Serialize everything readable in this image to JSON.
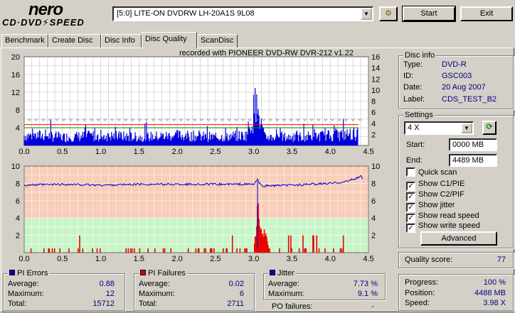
{
  "app": {
    "logo_top": "nero",
    "logo_bottom": "CD·DVD⚡SPEED"
  },
  "toolbar": {
    "drive": "[5:0]   LITE-ON DVDRW LH-20A1S 9L08",
    "start_label": "Start",
    "exit_label": "Exit"
  },
  "tabs": [
    {
      "label": "Benchmark"
    },
    {
      "label": "Create Disc"
    },
    {
      "label": "Disc Info"
    },
    {
      "label": "Disc Quality",
      "active": true
    },
    {
      "label": "ScanDisc"
    }
  ],
  "recorded_with": "recorded with PIONEER DVD-RW  DVR-212  v1.22",
  "disc_info": {
    "title": "Disc info",
    "type_label": "Type:",
    "type_value": "DVD-R",
    "id_label": "ID:",
    "id_value": "GSC003",
    "date_label": "Date:",
    "date_value": "20 Aug 2007",
    "label_label": "Label:",
    "label_value": "CDS_TEST_B2"
  },
  "settings": {
    "title": "Settings",
    "speed": "4 X",
    "start_label": "Start:",
    "start_value": "0000 MB",
    "end_label": "End:",
    "end_value": "4489 MB",
    "quick_scan": {
      "label": "Quick scan",
      "checked": false
    },
    "show_c1": {
      "label": "Show C1/PIE",
      "checked": true
    },
    "show_c2": {
      "label": "Show C2/PIF",
      "checked": true
    },
    "show_jitter": {
      "label": "Show jitter",
      "checked": true
    },
    "show_read": {
      "label": "Show read speed",
      "checked": true
    },
    "show_write": {
      "label": "Show write speed",
      "checked": true
    },
    "advanced_label": "Advanced"
  },
  "quality": {
    "label": "Quality score:",
    "value": "77"
  },
  "progress": {
    "progress_label": "Progress:",
    "progress_value": "100 %",
    "position_label": "Position:",
    "position_value": "4488 MB",
    "speed_label": "Speed:",
    "speed_value": "3.98 X"
  },
  "pi_errors": {
    "title": "PI Errors",
    "color": "#0000cc",
    "average_label": "Average:",
    "average": "0.88",
    "maximum_label": "Maximum:",
    "maximum": "12",
    "total_label": "Total:",
    "total": "15712"
  },
  "pi_failures": {
    "title": "PI Failures",
    "color": "#dd0000",
    "average_label": "Average:",
    "average": "0.02",
    "maximum_label": "Maximum:",
    "maximum": "6",
    "total_label": "Total:",
    "total": "2711"
  },
  "jitter": {
    "title": "Jitter",
    "color": "#0000cc",
    "average_label": "Average:",
    "average": "7.73 %",
    "maximum_label": "Maximum:",
    "maximum": "9.1 %"
  },
  "po_failures": {
    "label": "PO failures:",
    "value": "-"
  },
  "chart_data": [
    {
      "type": "bar",
      "name": "pi-errors-chart",
      "x_ticks": [
        "0.0",
        "0.5",
        "1.0",
        "1.5",
        "2.0",
        "2.5",
        "3.0",
        "3.5",
        "4.0",
        "4.5"
      ],
      "y_left_ticks": [
        "20",
        "16",
        "12",
        "8",
        "4"
      ],
      "y_right_ticks": [
        "16",
        "14",
        "12",
        "10",
        "8",
        "6",
        "4",
        "2"
      ],
      "xlim": [
        0,
        4.5
      ],
      "ylim": [
        0,
        20
      ],
      "pie_profile": [
        [
          0,
          3
        ],
        [
          0.3,
          3
        ],
        [
          0.5,
          2.5
        ],
        [
          1.0,
          3
        ],
        [
          1.5,
          2.5
        ],
        [
          2.0,
          3
        ],
        [
          2.5,
          2.5
        ],
        [
          2.9,
          3
        ],
        [
          2.98,
          8
        ],
        [
          3.02,
          12
        ],
        [
          3.06,
          10
        ],
        [
          3.1,
          6
        ],
        [
          3.14,
          2.5
        ],
        [
          3.5,
          2.5
        ],
        [
          4.0,
          3
        ],
        [
          4.37,
          3.5
        ]
      ],
      "red_line_y": 4.7,
      "read_speed_level": 4,
      "grid": true,
      "background": "#ffffff"
    },
    {
      "type": "bar",
      "name": "pi-failures-chart",
      "x_ticks": [
        "0.0",
        "0.5",
        "1.0",
        "1.5",
        "2.0",
        "2.5",
        "3.0",
        "3.5",
        "4.0",
        "4.5"
      ],
      "y_left_ticks": [
        "10",
        "8",
        "6",
        "4",
        "2"
      ],
      "y_right_ticks": [
        "10",
        "8",
        "6",
        "4",
        "2"
      ],
      "xlim": [
        0,
        4.5
      ],
      "ylim": [
        0,
        10
      ],
      "jitter": [
        [
          0,
          7.8
        ],
        [
          0.5,
          7.9
        ],
        [
          1.0,
          7.8
        ],
        [
          1.5,
          7.9
        ],
        [
          2.0,
          7.9
        ],
        [
          2.5,
          7.9
        ],
        [
          3.0,
          7.9
        ],
        [
          3.05,
          8.4
        ],
        [
          3.1,
          7.7
        ],
        [
          3.5,
          7.8
        ],
        [
          4.0,
          8.0
        ],
        [
          4.2,
          8.2
        ],
        [
          4.35,
          8.6
        ],
        [
          4.4,
          8.9
        ],
        [
          4.42,
          8.5
        ]
      ],
      "pif_spike": [
        [
          3.0,
          0.5
        ],
        [
          3.03,
          3
        ],
        [
          3.06,
          7.5
        ],
        [
          3.09,
          3
        ],
        [
          3.15,
          3
        ],
        [
          3.2,
          0.5
        ]
      ],
      "background_high": "#f8cdb9",
      "background_low": "#c8f5c8",
      "threshold": 4
    }
  ]
}
